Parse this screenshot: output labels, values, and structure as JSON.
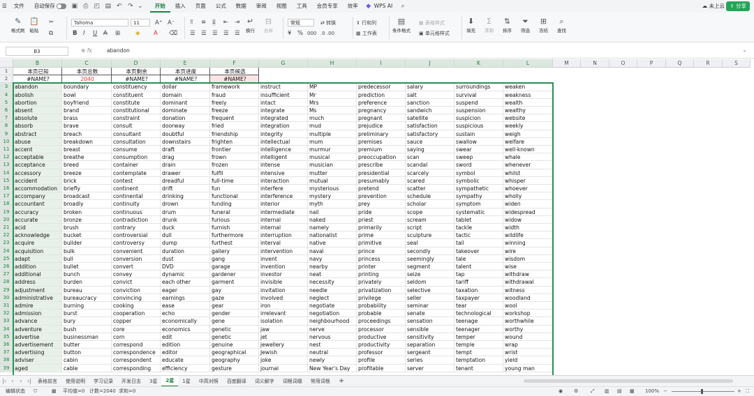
{
  "menubar": {
    "menu_icon": "☰",
    "file": "文件",
    "autosave": "自动保存",
    "tabs": [
      "开始",
      "插入",
      "页面",
      "公式",
      "数据",
      "审阅",
      "视图",
      "工具",
      "会员专享",
      "效率"
    ],
    "active_tab": "开始",
    "wps_ai": "WPS AI",
    "cloud": "未上云",
    "share": "分享"
  },
  "ribbon": {
    "format_painter": "格式刷",
    "paste": "粘贴",
    "font_name": "Tahoma",
    "font_size": "11",
    "wrap": "换行",
    "merge": "合并",
    "number_format": "常规",
    "convert": "转换",
    "row_col": "行和列",
    "worksheet": "工作表",
    "cond_format": "条件格式",
    "table_style": "表格样式",
    "cell_style": "单元格样式",
    "fill": "填充",
    "sum": "求和",
    "sort": "排序",
    "filter": "筛选",
    "freeze": "冻结",
    "find": "查找"
  },
  "formula": {
    "cell_ref": "B3",
    "fx": "fx",
    "value": "abandon"
  },
  "columns": [
    "B",
    "C",
    "D",
    "E",
    "F",
    "G",
    "H",
    "I",
    "J",
    "K",
    "L",
    "M",
    "N",
    "O",
    "P",
    "Q",
    "R",
    "S"
  ],
  "header_row": [
    "本页已知",
    "本页总数",
    "本页剩余",
    "本页进度",
    "本页候选"
  ],
  "value_row": [
    "#NAME?",
    "2040",
    "#NAME?",
    "#NAME?",
    "#NAME?"
  ],
  "row_numbers": [
    "1",
    "2",
    "3",
    "4",
    "5",
    "6",
    "7",
    "8",
    "9",
    "10",
    "11",
    "12",
    "13",
    "14",
    "15",
    "16",
    "17",
    "18",
    "19",
    "20",
    "21",
    "22",
    "23",
    "24",
    "25",
    "26",
    "27",
    "28",
    "29",
    "30",
    "31",
    "32",
    "33",
    "34",
    "35",
    "36",
    "37",
    "38",
    "39"
  ],
  "words": [
    [
      "abandon",
      "boundary",
      "constituency",
      "dollar",
      "framework",
      "instruct",
      "MP",
      "predecessor",
      "salary",
      "surroundings",
      "weaken"
    ],
    [
      "abolish",
      "bowl",
      "constituent",
      "domain",
      "fraud",
      "insufficient",
      "Mr",
      "prediction",
      "salt",
      "survival",
      "weakness"
    ],
    [
      "abortion",
      "boyfriend",
      "constitute",
      "dominant",
      "freely",
      "intact",
      "Mrs",
      "preference",
      "sanction",
      "suspend",
      "wealth"
    ],
    [
      "absent",
      "brand",
      "constitutional",
      "dominate",
      "freeze",
      "integrate",
      "Ms",
      "pregnancy",
      "sandwich",
      "suspension",
      "wealthy"
    ],
    [
      "absolute",
      "brass",
      "constraint",
      "donation",
      "frequent",
      "integrated",
      "much",
      "pregnant",
      "satellite",
      "suspicion",
      "website"
    ],
    [
      "absorb",
      "brave",
      "consult",
      "doorway",
      "fried",
      "integration",
      "mud",
      "prejudice",
      "satisfaction",
      "suspicious",
      "weekly"
    ],
    [
      "abstract",
      "breach",
      "consultant",
      "doubtful",
      "friendship",
      "integrity",
      "multiple",
      "preliminary",
      "satisfactory",
      "sustain",
      "weigh"
    ],
    [
      "abuse",
      "breakdown",
      "consultation",
      "downstairs",
      "frighten",
      "intellectual",
      "mum",
      "premises",
      "sauce",
      "swallow",
      "welfare"
    ],
    [
      "accent",
      "breast",
      "consume",
      "draft",
      "frontier",
      "intelligence",
      "murmur",
      "premium",
      "saying",
      "swear",
      "well-known"
    ],
    [
      "acceptable",
      "breathe",
      "consumption",
      "drag",
      "frown",
      "intelligent",
      "musical",
      "preoccupation",
      "scan",
      "sweep",
      "whale"
    ],
    [
      "acceptance",
      "breed",
      "container",
      "drain",
      "frozen",
      "intense",
      "musician",
      "prescribe",
      "scandal",
      "sword",
      "whenever"
    ],
    [
      "accessory",
      "breeze",
      "contemplate",
      "drawer",
      "fulfil",
      "intensive",
      "mutter",
      "presidential",
      "scarcely",
      "symbol",
      "whilst"
    ],
    [
      "accident",
      "brick",
      "contest",
      "dreadful",
      "full-time",
      "interaction",
      "mutual",
      "presumably",
      "scared",
      "symbolic",
      "whisper"
    ],
    [
      "accommodation",
      "briefly",
      "continent",
      "drift",
      "fun",
      "interfere",
      "mysterious",
      "pretend",
      "scatter",
      "sympathetic",
      "whoever"
    ],
    [
      "accompany",
      "broadcast",
      "continental",
      "drinking",
      "functional",
      "interference",
      "mystery",
      "prevention",
      "schedule",
      "sympathy",
      "wholly"
    ],
    [
      "accountant",
      "broadly",
      "continuity",
      "drown",
      "funding",
      "interior",
      "myth",
      "prey",
      "scholar",
      "symptom",
      "widen"
    ],
    [
      "accuracy",
      "broken",
      "continuous",
      "drum",
      "funeral",
      "intermediate",
      "nail",
      "pride",
      "scope",
      "systematic",
      "widespread"
    ],
    [
      "accurate",
      "bronze",
      "contradiction",
      "drunk",
      "furious",
      "internal",
      "naked",
      "priest",
      "scream",
      "tablet",
      "widow"
    ],
    [
      "acid",
      "brush",
      "contrary",
      "duck",
      "furnish",
      "internal",
      "namely",
      "primarily",
      "script",
      "tackle",
      "width"
    ],
    [
      "acknowledge",
      "bucket",
      "controversial",
      "dull",
      "furthermore",
      "interruption",
      "nationalist",
      "prime",
      "sculpture",
      "tactic",
      "wildlife"
    ],
    [
      "acquire",
      "builder",
      "controversy",
      "dump",
      "furthest",
      "interval",
      "native",
      "primitive",
      "seal",
      "tail",
      "winning"
    ],
    [
      "acquisition",
      "bulk",
      "convenient",
      "duration",
      "gallery",
      "intervention",
      "naval",
      "prince",
      "secondly",
      "takeover",
      "wire"
    ],
    [
      "adapt",
      "bull",
      "conversion",
      "dust",
      "gang",
      "invent",
      "navy",
      "princess",
      "seemingly",
      "tale",
      "wisdom"
    ],
    [
      "addition",
      "bullet",
      "convert",
      "DVD",
      "garage",
      "invention",
      "nearby",
      "printer",
      "segment",
      "talent",
      "wise"
    ],
    [
      "additional",
      "bunch",
      "convey",
      "dynamic",
      "gardener",
      "investor",
      "neat",
      "printing",
      "seize",
      "tap",
      "withdraw"
    ],
    [
      "address",
      "burden",
      "convict",
      "each other",
      "garment",
      "invisible",
      "necessity",
      "privately",
      "seldom",
      "tariff",
      "withdrawal"
    ],
    [
      "adjustment",
      "bureau",
      "conviction",
      "eager",
      "gay",
      "invitation",
      "needle",
      "privatization",
      "selective",
      "taxation",
      "witness"
    ],
    [
      "administrative",
      "bureaucracy",
      "convincing",
      "earnings",
      "gaze",
      "involved",
      "neglect",
      "privilege",
      "seller",
      "taxpayer",
      "woodland"
    ],
    [
      "admire",
      "burning",
      "cooking",
      "ease",
      "gear",
      "iron",
      "negotiate",
      "probability",
      "seminar",
      "tear",
      "wool"
    ],
    [
      "admission",
      "burst",
      "cooperation",
      "echo",
      "gender",
      "irrelevant",
      "negotiation",
      "probable",
      "senate",
      "technological",
      "workshop"
    ],
    [
      "advance",
      "bury",
      "copper",
      "economically",
      "gene",
      "isolation",
      "neighbourhood",
      "proceedings",
      "sensation",
      "teenage",
      "worthwhile"
    ],
    [
      "adventure",
      "bush",
      "core",
      "economics",
      "genetic",
      "jaw",
      "nerve",
      "processor",
      "sensible",
      "teenager",
      "worthy"
    ],
    [
      "advertise",
      "businessman",
      "corn",
      "edit",
      "genetic",
      "jet",
      "nervous",
      "productive",
      "sensitivity",
      "temper",
      "wound"
    ],
    [
      "advertisement",
      "butter",
      "correspond",
      "edition",
      "genuine",
      "jewellery",
      "nest",
      "productivity",
      "separation",
      "temple",
      "wrap"
    ],
    [
      "advertising",
      "button",
      "correspondence",
      "editor",
      "geographical",
      "Jewish",
      "neutral",
      "professor",
      "sergeant",
      "tempt",
      "wrist"
    ],
    [
      "adviser",
      "cabin",
      "correspondent",
      "educate",
      "geography",
      "joke",
      "newly",
      "profile",
      "series",
      "temptation",
      "yield"
    ],
    [
      "aged",
      "cable",
      "corresponding",
      "efficiency",
      "gesture",
      "journal",
      "New Year's Day",
      "profitable",
      "server",
      "tenant",
      "young man"
    ]
  ],
  "sheet_tabs": [
    "表格前言",
    "使用说明",
    "学习记录",
    "开发日志",
    "3星",
    "2星",
    "1星",
    "中高对照",
    "百度翻译",
    "词义解字",
    "词根词缀",
    "常用词根"
  ],
  "active_sheet": "2星",
  "status": {
    "mode": "编辑状态",
    "average": "平均值=0",
    "count": "计数=2040",
    "sum": "求和=0",
    "zoom": "100%"
  }
}
